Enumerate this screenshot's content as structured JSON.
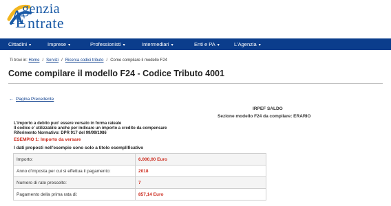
{
  "header": {
    "logo_line1": "genzia",
    "logo_line2": "ntrate"
  },
  "nav": {
    "items": [
      {
        "label": "Cittadini"
      },
      {
        "label": "Imprese"
      },
      {
        "label": "Professionisti"
      },
      {
        "label": "Intermediari"
      },
      {
        "label": "Enti e PA"
      },
      {
        "label": "L'Agenzia"
      }
    ],
    "chevron": "▾"
  },
  "breadcrumb": {
    "prefix": "Ti trovi in:",
    "links": [
      "Home",
      "Servizi",
      "Ricerca codici tributo"
    ],
    "current": "Come compilare il modello F24",
    "separator": "/"
  },
  "page": {
    "title": "Come compilare il modello F24 - Codice Tributo 4001",
    "back_arrow": "←",
    "back_label": "Pagina Precedente"
  },
  "content": {
    "irpef": "IRPEF SALDO",
    "sezione": "Sezione modello F24 da compilare: ERARIO",
    "notes": [
      "L'importo a debito puo' essere versato in forma rateale",
      "Il codice e' utilizzabile anche per indicare un importo a credito da compensare",
      "Riferimento Normativo: DPR  917 del 99/99/1986"
    ],
    "esempio": "ESEMPIO 1: Importo da versare",
    "dati": "I dati proposti nell'esempio sono solo a titolo esemplificativo",
    "rows": [
      {
        "label": "Importo:",
        "value": "6.000,00 Euro"
      },
      {
        "label": "Anno d'imposta per cui si effettua il pagamento:",
        "value": "2018"
      },
      {
        "label": "Numero di rate prescelto:",
        "value": "7"
      },
      {
        "label": "Pagamento della prima rata di:",
        "value": "857,14 Euro"
      }
    ]
  },
  "colors": {
    "nav_bg": "#0b3d8c",
    "logo_blue": "#1a5aa6",
    "logo_yellow": "#f2b51f",
    "accent_red": "#cc2a1d",
    "link": "#0b3d8c"
  },
  "icons": {
    "logo": "agenzia-entrate-logo",
    "back": "arrow-left-icon",
    "nav_chevron": "chevron-down-icon"
  }
}
